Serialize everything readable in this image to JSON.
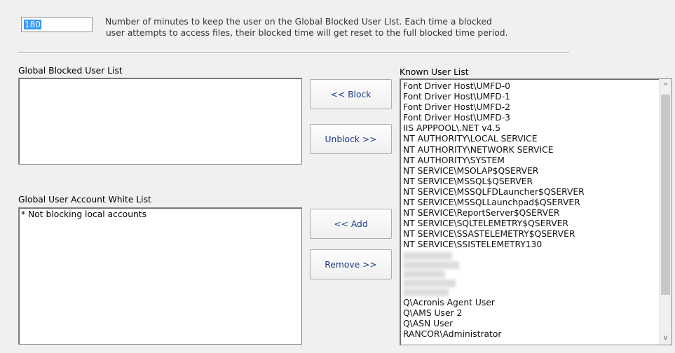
{
  "minutes": {
    "value": "180",
    "description_line1": "Number of minutes to keep the user on the Global Blocked User LIst.  Each time a blocked",
    "description_line2": "user attempts to access files, their blocked time will get reset to the full blocked time period."
  },
  "blocked_list": {
    "label": "Global Blocked User List",
    "items": []
  },
  "white_list": {
    "label": "Global User Account White List",
    "items": [
      "* Not blocking local accounts"
    ]
  },
  "buttons": {
    "block": "<< Block",
    "unblock": "Unblock >>",
    "add": "<< Add",
    "remove": "Remove >>"
  },
  "known_list": {
    "label": "Known User List",
    "items": [
      "Font Driver Host\\UMFD-0",
      "Font Driver Host\\UMFD-1",
      "Font Driver Host\\UMFD-2",
      "Font Driver Host\\UMFD-3",
      "IIS APPPOOL\\.NET v4.5",
      "NT AUTHORITY\\LOCAL SERVICE",
      "NT AUTHORITY\\NETWORK SERVICE",
      "NT AUTHORITY\\SYSTEM",
      "NT SERVICE\\MSOLAP$QSERVER",
      "NT SERVICE\\MSSQL$QSERVER",
      "NT SERVICE\\MSSQLFDLauncher$QSERVER",
      "NT SERVICE\\MSSQLLaunchpad$QSERVER",
      "NT SERVICE\\ReportServer$QSERVER",
      "NT SERVICE\\SQLTELEMETRY$QSERVER",
      "NT SERVICE\\SSASTELEMETRY$QSERVER",
      "NT SERVICE\\SSISTELEMETRY130",
      "",
      "",
      "",
      "",
      "",
      "Q\\Acronis Agent User",
      "Q\\AMS User 2",
      "Q\\ASN User",
      "RANCOR\\Administrator"
    ]
  },
  "scrollbar": {
    "up_arrow": "^",
    "down_arrow": "v"
  }
}
